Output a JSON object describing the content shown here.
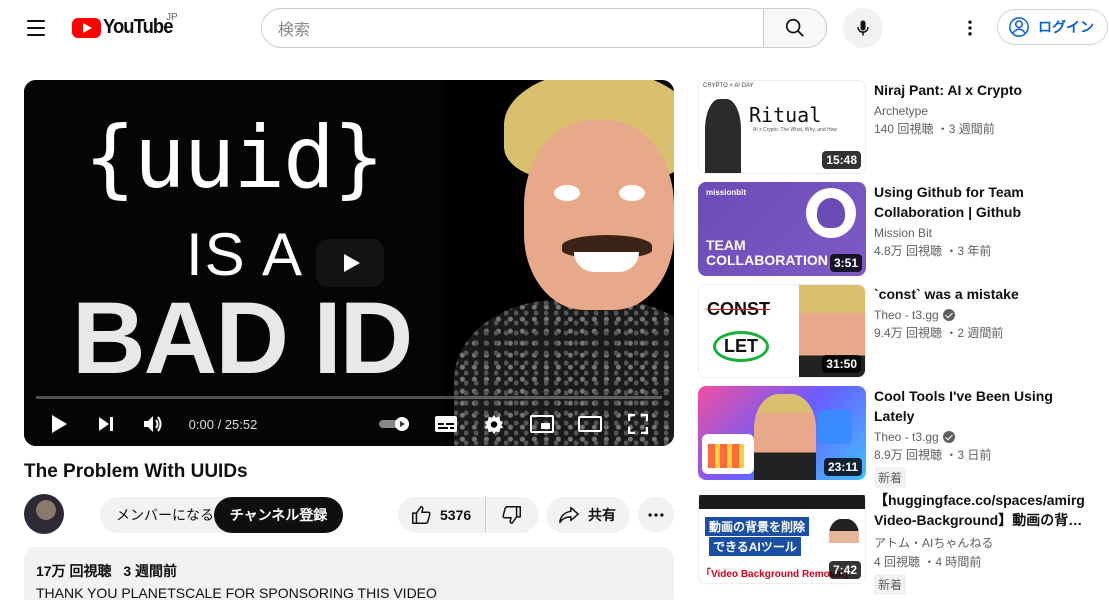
{
  "header": {
    "logo_text": "YouTube",
    "region": "JP",
    "search_placeholder": "検索",
    "login_label": "ログイン"
  },
  "player": {
    "thumb_line1": "{uuid}",
    "thumb_line2": "IS A",
    "thumb_line3": "BAD ID",
    "time": "0:00 / 25:52",
    "progress_fraction": 0.0
  },
  "video": {
    "title": "The Problem With UUIDs",
    "member_label": "メンバーになる",
    "subscribe_label": "チャンネル登録",
    "like_count": "5376",
    "share_label": "共有",
    "views": "17万 回視聴",
    "posted": "3 週間前",
    "description": "THANK YOU PLANETSCALE FOR SPONSORING THIS VIDEO"
  },
  "recommendations": [
    {
      "title": "Niraj Pant: AI x Crypto",
      "channel": "Archetype",
      "verified": false,
      "meta": "140 回視聴 ・3 週間前",
      "duration": "15:48",
      "new": "",
      "thumb_top": "CRYPTO × AI DAY",
      "thumb_title": "Ritual",
      "thumb_sub": "AI x Crypto: The What, Why, and How"
    },
    {
      "title": "Using Github for Team Collaboration | Github Tutorial…",
      "channel": "Mission Bit",
      "verified": false,
      "meta": "4.8万 回視聴 ・3 年前",
      "duration": "3:51",
      "new": "",
      "thumb_brand": "missionbit",
      "thumb_line1": "TEAM",
      "thumb_line2": "COLLABORATION"
    },
    {
      "title": "`const` was a mistake",
      "channel": "Theo - t3.gg",
      "verified": true,
      "meta": "9.4万 回視聴 ・2 週間前",
      "duration": "31:50",
      "new": "",
      "thumb_line1": "CONST",
      "thumb_line2": "LET"
    },
    {
      "title": "Cool Tools I've Been Using Lately",
      "channel": "Theo - t3.gg",
      "verified": true,
      "meta": "8.9万 回視聴 ・3 日前",
      "duration": "23:11",
      "new": "新着"
    },
    {
      "title": "【huggingface.co/spaces/amirg Video-Background】動画の背…",
      "channel": "アトム・AIちゃんねる",
      "verified": false,
      "meta": "4 回視聴 ・4 時間前",
      "duration": "7:42",
      "new": "新着",
      "thumb_line1": "動画の背景を削除",
      "thumb_line2": "できるAIツール",
      "thumb_line3": "「Video Background Removal」"
    }
  ],
  "colors": {
    "brand_red": "#ff0000",
    "link_blue": "#065fd4",
    "chip_bg": "#f2f2f2"
  }
}
